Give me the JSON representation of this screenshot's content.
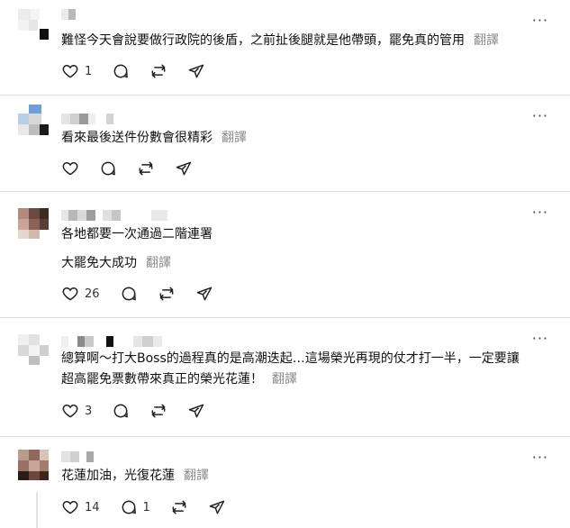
{
  "labels": {
    "translate": "翻譯",
    "more": "···"
  },
  "posts": [
    {
      "text1": "難怪今天會說要做行政院的後盾，之前扯後腿就是他帶頭，罷免真的管用",
      "likes": "1",
      "comments": "",
      "reposts": ""
    },
    {
      "text1": "看來最後送件份數會很精彩",
      "likes": "",
      "comments": "",
      "reposts": ""
    },
    {
      "text1": "各地都要一次通過二階連署",
      "text2": "大罷免大成功",
      "likes": "26",
      "comments": "",
      "reposts": ""
    },
    {
      "text1": "總算啊～打大Boss的過程真的是高潮迭起…這場榮光再現的仗才打一半，一定要讓",
      "text2": "超高罷免票數帶來真正的榮光花蓮！",
      "likes": "3",
      "comments": "",
      "reposts": ""
    },
    {
      "text1": "花蓮加油，光復花蓮",
      "likes": "14",
      "comments": "1",
      "reposts": ""
    }
  ]
}
